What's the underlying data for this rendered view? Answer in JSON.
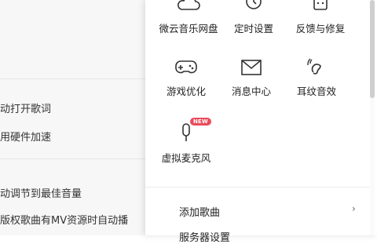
{
  "settings": {
    "options": [
      "动打开歌词",
      "用硬件加速",
      "动调节到最佳音量",
      "版权歌曲有MV资源时自动播"
    ]
  },
  "menu": {
    "tiles": [
      {
        "label": "微云音乐网盘",
        "icon": "cloud-icon"
      },
      {
        "label": "定时设置",
        "icon": "alarm-clock-icon"
      },
      {
        "label": "反馈与修复",
        "icon": "feedback-icon"
      },
      {
        "label": "游戏优化",
        "icon": "gamepad-icon"
      },
      {
        "label": "消息中心",
        "icon": "mail-icon"
      },
      {
        "label": "耳纹音效",
        "icon": "ear-icon"
      },
      {
        "label": "虚拟麦克风",
        "icon": "microphone-icon"
      }
    ],
    "new_badge": "NEW",
    "rows": [
      {
        "label": "添加歌曲"
      },
      {
        "label": "服务器设置"
      }
    ],
    "accent": "#e94b5b"
  }
}
